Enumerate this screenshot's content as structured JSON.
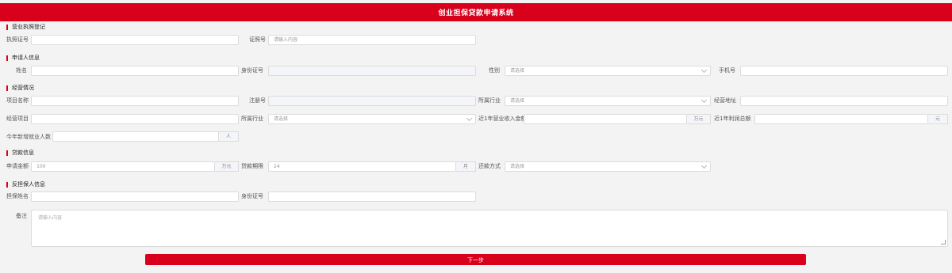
{
  "header": {
    "title": "创业担保贷款申请系统"
  },
  "sections": {
    "business": "营业执照登记",
    "applicant": "申请人信息",
    "operation": "经营情况",
    "loan": "贷款信息",
    "guarantor": "反担保人信息"
  },
  "fields": {
    "license_no": {
      "label": "执照证号",
      "value": ""
    },
    "contact_phone": {
      "label": "证照号",
      "placeholder": "请输入内容"
    },
    "name": {
      "label": "姓名",
      "value": ""
    },
    "id_card": {
      "label": "身份证号",
      "value": ""
    },
    "gender": {
      "label": "性别",
      "placeholder": "请选择"
    },
    "phone": {
      "label": "手机号",
      "value": ""
    },
    "project_name": {
      "label": "项目名称",
      "value": ""
    },
    "credit_code": {
      "label": "注册号",
      "value": ""
    },
    "gov_sector": {
      "label": "所属行业",
      "placeholder": "请选择"
    },
    "business_address": {
      "label": "经营地址",
      "value": ""
    },
    "operation_project": {
      "label": "经营项目",
      "value": ""
    },
    "industry": {
      "label": "所属行业",
      "placeholder": "请选择"
    },
    "annual_income": {
      "label": "近1年营业收入金额",
      "unit": "万元"
    },
    "profit": {
      "label": "近1年利润总额",
      "unit": "元"
    },
    "employees": {
      "label": "今年新增就业人数",
      "unit": "人"
    },
    "loan_amount": {
      "label": "申请金额",
      "value": "100",
      "unit": "万元"
    },
    "loan_term": {
      "label": "贷款期限",
      "value": "24",
      "unit": "月"
    },
    "repay_method": {
      "label": "还款方式",
      "placeholder": "请选择"
    },
    "guarantor_name": {
      "label": "担保姓名",
      "value": ""
    },
    "guarantor_id": {
      "label": "身份证号",
      "value": ""
    },
    "remark": {
      "label": "备注",
      "placeholder": "请输入内容"
    }
  },
  "actions": {
    "next": "下一步"
  },
  "colors": {
    "brand": "#d9001b"
  }
}
